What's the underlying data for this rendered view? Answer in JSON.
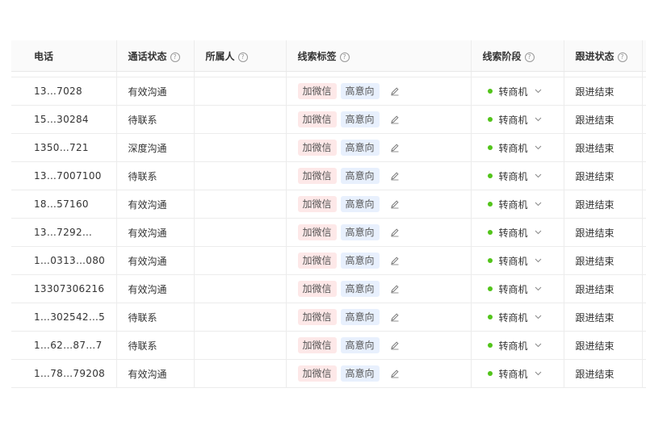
{
  "table": {
    "columns": [
      {
        "key": "phone",
        "label": "电话",
        "help": false
      },
      {
        "key": "call_status",
        "label": "通话状态",
        "help": true
      },
      {
        "key": "owner",
        "label": "所属人",
        "help": true
      },
      {
        "key": "tags",
        "label": "线索标签",
        "help": true
      },
      {
        "key": "stage",
        "label": "线索阶段",
        "help": true
      },
      {
        "key": "follow",
        "label": "跟进状态",
        "help": true
      }
    ],
    "help_glyph": "?",
    "rows": [
      {
        "phone": "13…7028",
        "call_status": "有效沟通",
        "owner": "",
        "tags": [
          "加微信",
          "高意向"
        ],
        "stage": "转商机",
        "follow": "跟进结束"
      },
      {
        "phone": "15…30284",
        "call_status": "待联系",
        "owner": "",
        "tags": [
          "加微信",
          "高意向"
        ],
        "stage": "转商机",
        "follow": "跟进结束"
      },
      {
        "phone": "1350…721",
        "call_status": "深度沟通",
        "owner": "",
        "tags": [
          "加微信",
          "高意向"
        ],
        "stage": "转商机",
        "follow": "跟进结束"
      },
      {
        "phone": "13…7007100",
        "call_status": "待联系",
        "owner": "",
        "tags": [
          "加微信",
          "高意向"
        ],
        "stage": "转商机",
        "follow": "跟进结束"
      },
      {
        "phone": "18…57160",
        "call_status": "有效沟通",
        "owner": "",
        "tags": [
          "加微信",
          "高意向"
        ],
        "stage": "转商机",
        "follow": "跟进结束"
      },
      {
        "phone": "13…7292…",
        "call_status": "有效沟通",
        "owner": "",
        "tags": [
          "加微信",
          "高意向"
        ],
        "stage": "转商机",
        "follow": "跟进结束"
      },
      {
        "phone": "1…0313…080",
        "call_status": "有效沟通",
        "owner": "",
        "tags": [
          "加微信",
          "高意向"
        ],
        "stage": "转商机",
        "follow": "跟进结束"
      },
      {
        "phone": "13307306216",
        "call_status": "有效沟通",
        "owner": "",
        "tags": [
          "加微信",
          "高意向"
        ],
        "stage": "转商机",
        "follow": "跟进结束"
      },
      {
        "phone": "1…302542…5",
        "call_status": "待联系",
        "owner": "",
        "tags": [
          "加微信",
          "高意向"
        ],
        "stage": "转商机",
        "follow": "跟进结束"
      },
      {
        "phone": "1…62…87…7",
        "call_status": "待联系",
        "owner": "",
        "tags": [
          "加微信",
          "高意向"
        ],
        "stage": "转商机",
        "follow": "跟进结束"
      },
      {
        "phone": "1…78…79208",
        "call_status": "有效沟通",
        "owner": "",
        "tags": [
          "加微信",
          "高意向"
        ],
        "stage": "转商机",
        "follow": "跟进结束"
      }
    ]
  },
  "colors": {
    "stage_dot": "#52c41a",
    "tag_wechat_bg": "#fde8e8",
    "tag_intent_bg": "#e8f0fd",
    "header_bg": "#fafafa",
    "border": "#ececec"
  },
  "icons": {
    "help": "question-circle-icon",
    "edit": "pencil-icon",
    "dropdown": "chevron-down-icon"
  }
}
